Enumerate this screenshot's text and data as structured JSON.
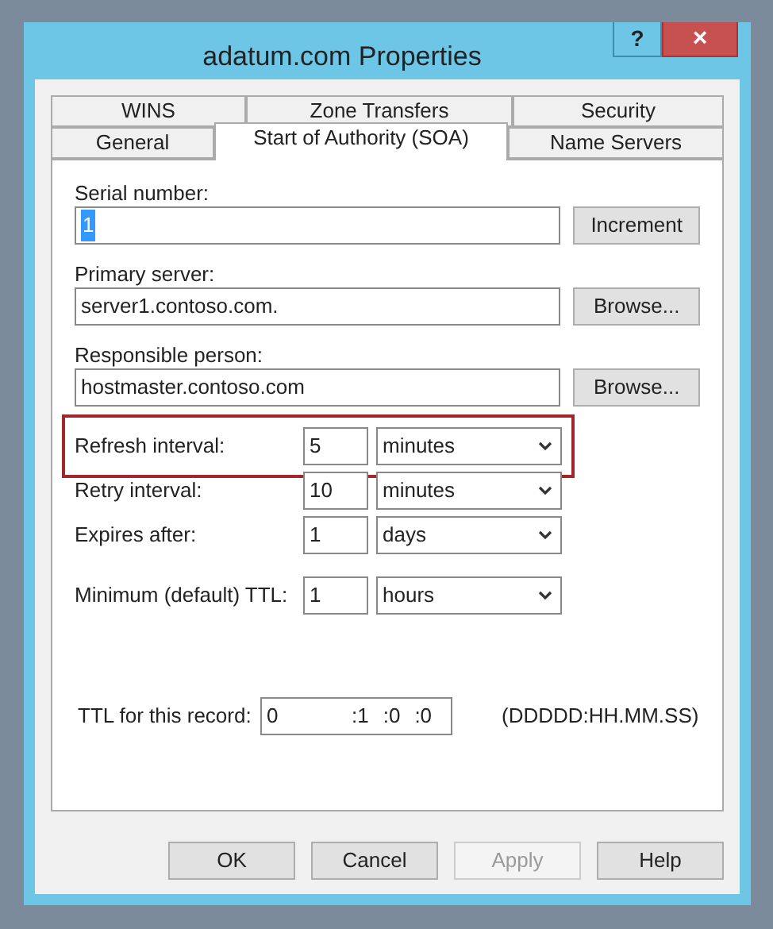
{
  "window": {
    "title": "adatum.com Properties",
    "controls": [
      {
        "kind": "help",
        "label": "?"
      },
      {
        "kind": "close",
        "label": "×"
      }
    ]
  },
  "tabs": [
    [
      {
        "label": "WINS",
        "selected": false
      },
      {
        "label": "Zone Transfers",
        "selected": false
      },
      {
        "label": "Security",
        "selected": false
      }
    ],
    [
      {
        "label": "General",
        "selected": false
      },
      {
        "label": "Start of Authority (SOA)",
        "selected": true
      },
      {
        "label": "Name Servers",
        "selected": false
      }
    ]
  ],
  "fields": [
    {
      "label": "Serial number:",
      "value": "1",
      "value_selected": true,
      "button": "Increment"
    },
    {
      "label": "Primary server:",
      "value": "server1.contoso.com.",
      "value_selected": false,
      "button": "Browse..."
    },
    {
      "label": "Responsible person:",
      "value": "hostmaster.contoso.com",
      "value_selected": false,
      "button": "Browse..."
    }
  ],
  "intervals": [
    {
      "label": "Refresh interval:",
      "value": "5",
      "unit": "minutes",
      "highlighted": true
    },
    {
      "label": "Retry interval:",
      "value": "10",
      "unit": "minutes",
      "highlighted": false
    },
    {
      "label": "Expires after:",
      "value": "1",
      "unit": "days",
      "highlighted": false
    },
    {
      "label": "Minimum (default) TTL:",
      "value": "1",
      "unit": "hours",
      "highlighted": false
    }
  ],
  "ttl": {
    "label": "TTL for this record:",
    "parts": [
      "0",
      ":1",
      ":0",
      ":0"
    ],
    "format": "(DDDDD:HH.MM.SS)"
  },
  "buttons": [
    {
      "label": "OK",
      "disabled": false
    },
    {
      "label": "Cancel",
      "disabled": false
    },
    {
      "label": "Apply",
      "disabled": true
    },
    {
      "label": "Help",
      "disabled": false
    }
  ]
}
